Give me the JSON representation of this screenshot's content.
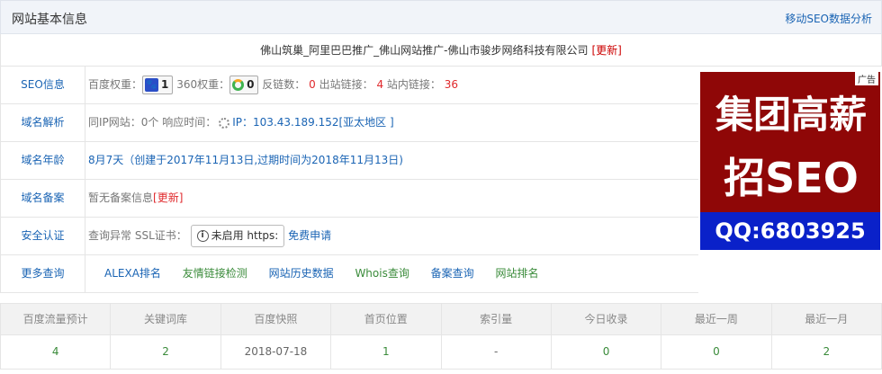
{
  "header": {
    "title": "网站基本信息",
    "right_link": "移动SEO数据分析"
  },
  "site": {
    "title": "佛山筑巢_阿里巴巴推广_佛山网站推广-佛山市骏步网络科技有限公司",
    "update": "[更新]"
  },
  "seo": {
    "label": "SEO信息",
    "baidu_label": "百度权重：",
    "baidu_value": "1",
    "r360_label": "360权重：",
    "r360_value": "0",
    "backlinks_label": "反链数：",
    "backlinks_value": "0",
    "outlinks_label": "出站链接：",
    "outlinks_value": "4",
    "inlinks_label": "站内链接：",
    "inlinks_value": "36"
  },
  "domain": {
    "label": "域名解析",
    "same_ip": "同IP网站：0个",
    "response": "响应时间：",
    "ip": "IP：103.43.189.152[亚太地区 ]"
  },
  "age": {
    "label": "域名年龄",
    "text": "8月7天（创建于2017年11月13日,过期时间为2018年11月13日)"
  },
  "record": {
    "label": "域名备案",
    "text": "暂无备案信息",
    "update": "[更新]"
  },
  "security": {
    "label": "安全认证",
    "status": "查询异常",
    "ssl_label": "SSL证书：",
    "https_text": "未启用 https:",
    "apply": "免费申请"
  },
  "more": {
    "label": "更多查询",
    "links": [
      "ALEXA排名",
      "友情链接检测",
      "网站历史数据",
      "Whois查询",
      "备案查询",
      "网站排名"
    ]
  },
  "ad": {
    "tag": "广告",
    "line1": "集团高薪",
    "line2": "招SEO",
    "qq": "QQ:6803925",
    "bg_color": "#8f0707",
    "qq_bg_color": "#0a21c9"
  },
  "stats": {
    "headers": [
      "百度流量预计",
      "关键词库",
      "百度快照",
      "首页位置",
      "索引量",
      "今日收录",
      "最近一周",
      "最近一月"
    ],
    "values": [
      "4",
      "2",
      "2018-07-18",
      "1",
      "-",
      "0",
      "0",
      "2"
    ]
  }
}
